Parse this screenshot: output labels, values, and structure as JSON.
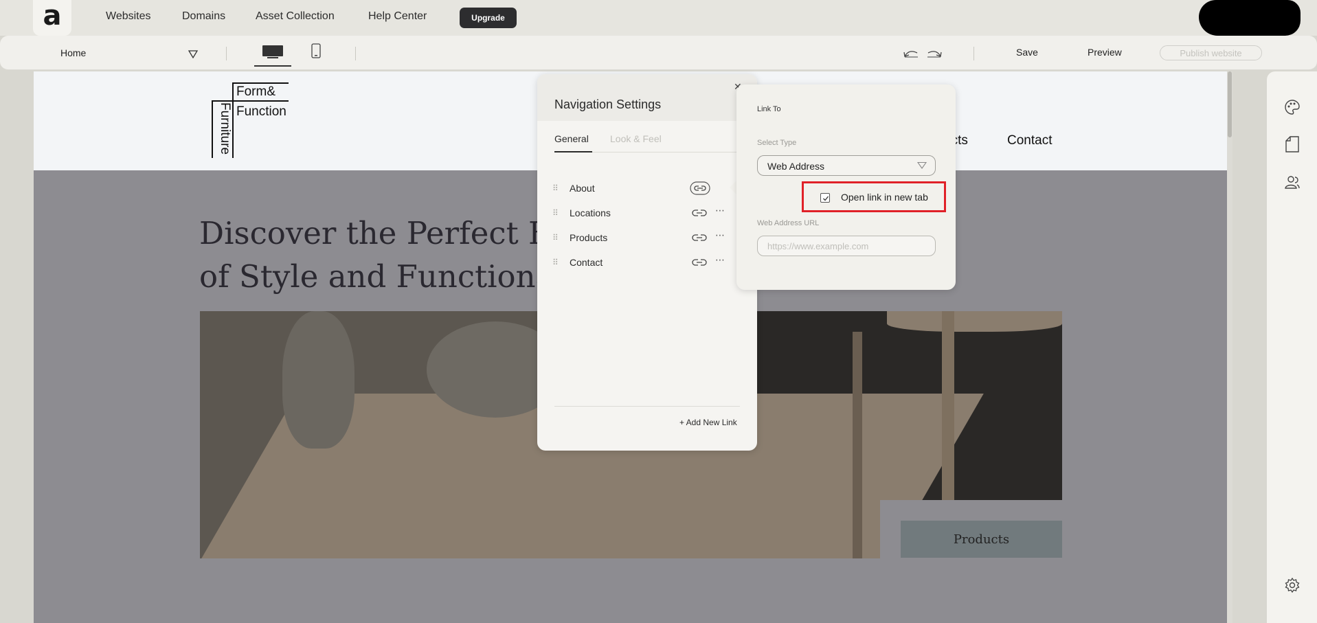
{
  "topnav": {
    "logo_letter": "a",
    "links": [
      "Websites",
      "Domains",
      "Asset Collection",
      "Help Center"
    ],
    "upgrade_label": "Upgrade"
  },
  "toolbar": {
    "page_selected": "Home",
    "save_label": "Save",
    "preview_label": "Preview",
    "publish_label": "Publish website"
  },
  "site": {
    "brand_line1": "Form&",
    "brand_line2": "Function",
    "brand_vertical": "Furniture",
    "nav_visible": [
      "ucts",
      "Contact"
    ],
    "hero_title_line1": "Discover the Perfect Bl",
    "hero_title_line2": "of Style and Functiona",
    "cta_label": "Products"
  },
  "nav_settings": {
    "title": "Navigation Settings",
    "tabs": [
      "General",
      "Look & Feel"
    ],
    "items": [
      {
        "label": "About"
      },
      {
        "label": "Locations"
      },
      {
        "label": "Products"
      },
      {
        "label": "Contact"
      }
    ],
    "add_link_label": "+ Add New Link"
  },
  "link_to": {
    "title": "Link To",
    "select_type_label": "Select Type",
    "select_type_value": "Web Address",
    "checkbox_label": "Open link in new tab",
    "checkbox_checked": true,
    "url_label": "Web Address URL",
    "url_placeholder": "https://www.example.com",
    "url_value": ""
  },
  "colors": {
    "highlight": "#e02128",
    "upgrade_bg": "#2d2d2f",
    "hero_overlay": "#8d8c91"
  },
  "icons": [
    "monitor-icon",
    "mobile-icon",
    "undo-icon",
    "redo-icon",
    "palette-icon",
    "page-icon",
    "users-icon",
    "settings-gear-icon",
    "link-icon",
    "drag-handle-icon",
    "more-icon",
    "close-icon",
    "chevron-down-icon",
    "checkmark-icon"
  ]
}
